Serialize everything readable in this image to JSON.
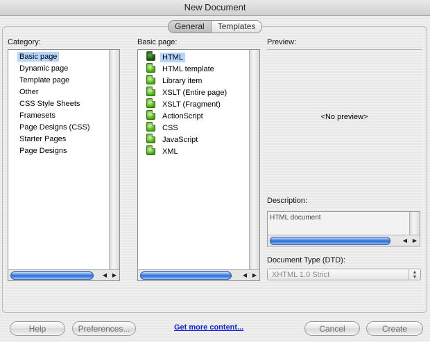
{
  "window": {
    "title": "New Document"
  },
  "tabs": [
    {
      "label": "General",
      "active": true
    },
    {
      "label": "Templates",
      "active": false
    }
  ],
  "category": {
    "label": "Category:",
    "items": [
      {
        "label": "Basic page",
        "selected": true
      },
      {
        "label": "Dynamic page"
      },
      {
        "label": "Template page"
      },
      {
        "label": "Other"
      },
      {
        "label": "CSS Style Sheets"
      },
      {
        "label": "Framesets"
      },
      {
        "label": "Page Designs (CSS)"
      },
      {
        "label": "Starter Pages"
      },
      {
        "label": "Page Designs"
      }
    ]
  },
  "basic_page": {
    "label": "Basic page:",
    "items": [
      {
        "label": "HTML",
        "selected": true
      },
      {
        "label": "HTML template"
      },
      {
        "label": "Library item"
      },
      {
        "label": "XSLT (Entire page)"
      },
      {
        "label": "XSLT (Fragment)"
      },
      {
        "label": "ActionScript"
      },
      {
        "label": "CSS"
      },
      {
        "label": "JavaScript"
      },
      {
        "label": "XML"
      }
    ]
  },
  "preview": {
    "label": "Preview:",
    "placeholder": "<No preview>"
  },
  "description": {
    "label": "Description:",
    "text": "HTML document"
  },
  "doctype": {
    "label": "Document Type (DTD):",
    "value": "XHTML 1.0 Strict"
  },
  "buttons": {
    "help": "Help",
    "preferences": "Preferences...",
    "more_content": "Get more content...",
    "cancel": "Cancel",
    "create": "Create"
  },
  "colors": {
    "selection": "#b5d4fe",
    "link": "#1122cc"
  }
}
